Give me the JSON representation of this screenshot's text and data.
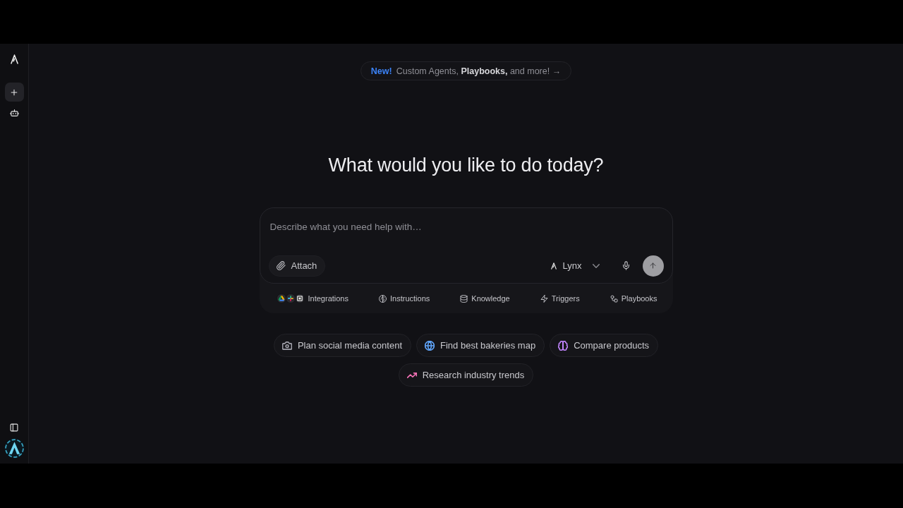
{
  "sidebar": {
    "nav": [
      {
        "kind": "plus",
        "selected": true
      },
      {
        "kind": "bot",
        "selected": false
      }
    ]
  },
  "banner": {
    "badge": "New!",
    "text": "Custom Agents, **Playbooks,** and more! →"
  },
  "heading": "What would you like to do today?",
  "composer": {
    "placeholder": "Describe what you need help with…",
    "attach": "Attach",
    "model": "Lynx",
    "send": {
      "disabled": true
    }
  },
  "tools": [
    {
      "kind": "integrations",
      "label": "Integrations"
    },
    {
      "kind": "instructions",
      "label": "Instructions"
    },
    {
      "kind": "knowledge",
      "label": "Knowledge"
    },
    {
      "kind": "triggers",
      "label": "Triggers"
    },
    {
      "kind": "playbooks",
      "label": "Playbooks"
    }
  ],
  "suggestions": [
    {
      "kind": "camera",
      "label": "Plan social media content",
      "color": "#a1a1aa"
    },
    {
      "kind": "globe",
      "label": "Find best bakeries map",
      "color": "#60a5fa"
    },
    {
      "kind": "brain",
      "label": "Compare products",
      "color": "#c084fc"
    },
    {
      "kind": "trend",
      "label": "Research industry trends",
      "color": "#f472b6"
    }
  ]
}
